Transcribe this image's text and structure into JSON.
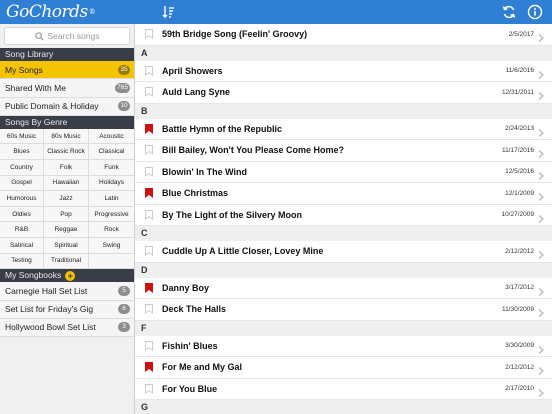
{
  "app": {
    "logo": "GoChords",
    "logo_mark": "®"
  },
  "toolbar": {
    "sort_icon": "sort-icon",
    "sync_icon": "sync-icon",
    "info_icon": "info-icon"
  },
  "search": {
    "placeholder": "Search songs"
  },
  "library": {
    "header": "Song Library",
    "items": [
      {
        "label": "My Songs",
        "count": "35",
        "active": true
      },
      {
        "label": "Shared With Me",
        "count": "765",
        "active": false
      },
      {
        "label": "Public Domain & Holiday",
        "count": "10",
        "active": false
      }
    ]
  },
  "genres": {
    "header": "Songs By Genre",
    "items": [
      "60s Music",
      "80s Music",
      "Acoustic",
      "Blues",
      "Classic Rock",
      "Classical",
      "Country",
      "Folk",
      "Funk",
      "Gospel",
      "Hawaiian",
      "Holidays",
      "Humorous",
      "Jazz",
      "Latin",
      "Oldies",
      "Pop",
      "Progressive",
      "R&B",
      "Reggae",
      "Rock",
      "Satirical",
      "Spiritual",
      "Swing",
      "Testing",
      "Traditional",
      ""
    ]
  },
  "songbooks": {
    "header": "My Songbooks",
    "add_label": "+",
    "items": [
      {
        "label": "Carnegie Hall Set List",
        "count": "5"
      },
      {
        "label": "Set List for Friday's Gig",
        "count": "6"
      },
      {
        "label": "Hollywood Bowl Set List",
        "count": "3"
      }
    ]
  },
  "songs": [
    {
      "type": "song",
      "title": "59th Bridge Song (Feelin' Groovy)",
      "date": "2/5/2017",
      "bookmarked": false
    },
    {
      "type": "letter",
      "label": "A"
    },
    {
      "type": "song",
      "title": "April Showers",
      "date": "11/6/2016",
      "bookmarked": false
    },
    {
      "type": "song",
      "title": "Auld Lang Syne",
      "date": "12/31/2011",
      "bookmarked": false
    },
    {
      "type": "letter",
      "label": "B"
    },
    {
      "type": "song",
      "title": "Battle Hymn of the Republic",
      "date": "2/24/2013",
      "bookmarked": true
    },
    {
      "type": "song",
      "title": "Bill Bailey, Won't You Please Come Home?",
      "date": "11/17/2016",
      "bookmarked": false
    },
    {
      "type": "song",
      "title": "Blowin' In The Wind",
      "date": "12/5/2016",
      "bookmarked": false
    },
    {
      "type": "song",
      "title": "Blue Christmas",
      "date": "12/1/2009",
      "bookmarked": true
    },
    {
      "type": "song",
      "title": "By The Light of the Silvery Moon",
      "date": "10/27/2009",
      "bookmarked": false
    },
    {
      "type": "letter",
      "label": "C"
    },
    {
      "type": "song",
      "title": "Cuddle Up A Little Closer, Lovey Mine",
      "date": "2/12/2012",
      "bookmarked": false
    },
    {
      "type": "letter",
      "label": "D"
    },
    {
      "type": "song",
      "title": "Danny Boy",
      "date": "3/17/2012",
      "bookmarked": true
    },
    {
      "type": "song",
      "title": "Deck The Halls",
      "date": "11/30/2009",
      "bookmarked": false
    },
    {
      "type": "letter",
      "label": "F"
    },
    {
      "type": "song",
      "title": "Fishin' Blues",
      "date": "3/30/2009",
      "bookmarked": false
    },
    {
      "type": "song",
      "title": "For Me and My Gal",
      "date": "2/12/2012",
      "bookmarked": true
    },
    {
      "type": "song",
      "title": "For You Blue",
      "date": "2/17/2010",
      "bookmarked": false
    },
    {
      "type": "letter",
      "label": "G"
    }
  ],
  "colors": {
    "accent": "#2f7fd4",
    "selected": "#f5c400",
    "bookmark": "#cc1111",
    "section_header": "#383d48"
  }
}
